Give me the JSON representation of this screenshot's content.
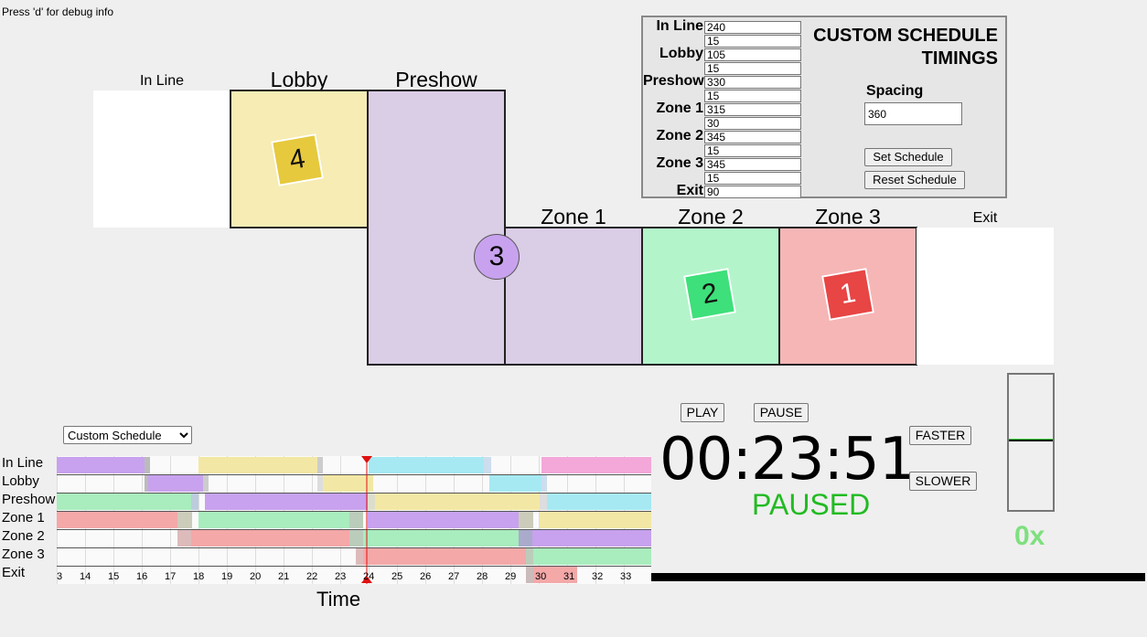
{
  "debug_hint": "Press 'd' for debug info",
  "rooms": {
    "in_line": "In Line",
    "lobby": "Lobby",
    "preshow": "Preshow",
    "zone1": "Zone 1",
    "zone2": "Zone 2",
    "zone3": "Zone 3",
    "exit": "Exit"
  },
  "tokens": {
    "lobby": "4",
    "preshow": "3",
    "zone2": "2",
    "zone3": "1"
  },
  "schedule_panel": {
    "title_line1": "CUSTOM SCHEDULE",
    "title_line2": "TIMINGS",
    "rows": [
      {
        "label": "In Line",
        "duration": "240",
        "gap": "15"
      },
      {
        "label": "Lobby",
        "duration": "105",
        "gap": "15"
      },
      {
        "label": "Preshow",
        "duration": "330",
        "gap": "15"
      },
      {
        "label": "Zone 1",
        "duration": "315",
        "gap": "30"
      },
      {
        "label": "Zone 2",
        "duration": "345",
        "gap": "15"
      },
      {
        "label": "Zone 3",
        "duration": "345",
        "gap": "15"
      },
      {
        "label": "Exit",
        "duration": "90",
        "gap": ""
      }
    ],
    "spacing_label": "Spacing",
    "spacing_value": "360",
    "set_button": "Set Schedule",
    "reset_button": "Reset Schedule"
  },
  "controls": {
    "schedule_select": "Custom Schedule",
    "play": "PLAY",
    "pause": "PAUSE",
    "faster": "FASTER",
    "slower": "SLOWER",
    "clock": "00:23:51",
    "status": "PAUSED",
    "speed": "0x"
  },
  "timeline": {
    "row_labels": [
      "In Line",
      "Lobby",
      "Preshow",
      "Zone 1",
      "Zone 2",
      "Zone 3",
      "Exit"
    ],
    "ticks": [
      "3",
      "14",
      "15",
      "16",
      "17",
      "18",
      "19",
      "20",
      "21",
      "22",
      "23",
      "24",
      "25",
      "26",
      "27",
      "28",
      "29",
      "30",
      "31",
      "32",
      "33"
    ],
    "axis_label": "Time",
    "colors": {
      "purple": "#c8a2ee",
      "yellow": "#f3e7a5",
      "green": "#a9ecbe",
      "red": "#f4a8a8",
      "cyan": "#a6e9f3",
      "pink": "#f3a8d9"
    }
  }
}
